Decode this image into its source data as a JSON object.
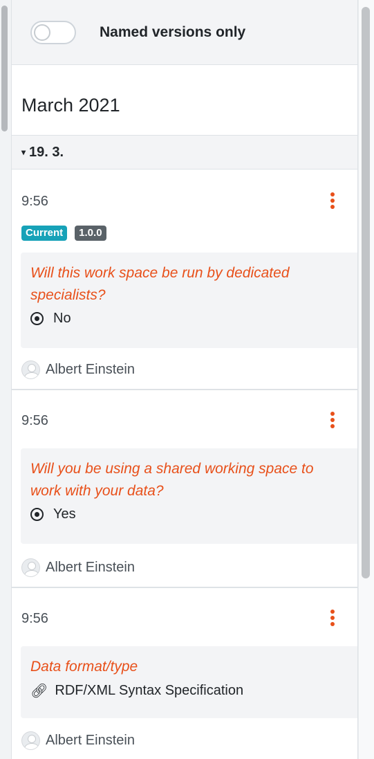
{
  "filter": {
    "named_versions_label": "Named versions only",
    "toggle_on": false
  },
  "month": "March 2021",
  "day": {
    "caret": "▾",
    "label": "19. 3."
  },
  "events": [
    {
      "time": "9:56",
      "badges": {
        "current": "Current",
        "version": "1.0.0"
      },
      "question": "Will this work space be run by dedicated specialists?",
      "answer": "No",
      "answer_icon": "radio-selected-icon",
      "author": "Albert Einstein"
    },
    {
      "time": "9:56",
      "question": "Will you be using a shared working space to work with your data?",
      "answer": "Yes",
      "answer_icon": "radio-selected-icon",
      "author": "Albert Einstein"
    },
    {
      "time": "9:56",
      "question": "Data format/type",
      "answer": "RDF/XML Syntax Specification",
      "answer_icon": "link-icon",
      "author": "Albert Einstein"
    }
  ],
  "colors": {
    "accent": "#e8501a",
    "badge_current": "#17a2b8",
    "badge_version": "#5a6268"
  }
}
